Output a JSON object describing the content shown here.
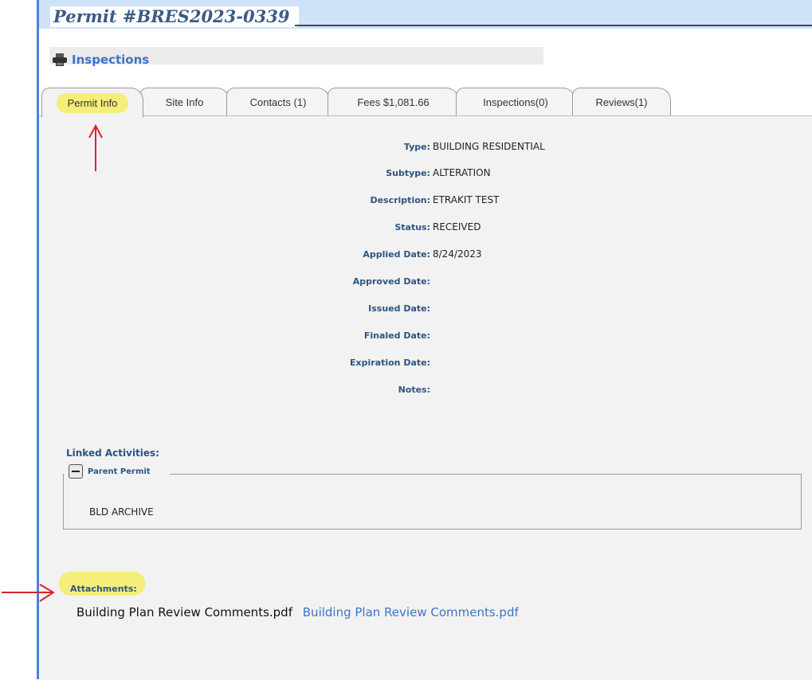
{
  "header": {
    "title": "Permit #BRES2023-0339",
    "inspections_link": "Inspections"
  },
  "tabs": [
    {
      "label": "Permit Info",
      "active": true
    },
    {
      "label": "Site Info"
    },
    {
      "label": "Contacts (1)"
    },
    {
      "label": "Fees $1,081.66"
    },
    {
      "label": "Inspections(0)"
    },
    {
      "label": "Reviews(1)"
    }
  ],
  "fields": [
    {
      "label": "Type:",
      "value": "BUILDING RESIDENTIAL"
    },
    {
      "label": "Subtype:",
      "value": "ALTERATION"
    },
    {
      "label": "Description:",
      "value": "ETRAKIT TEST"
    },
    {
      "label": "Status:",
      "value": "RECEIVED"
    },
    {
      "label": "Applied Date:",
      "value": "8/24/2023"
    },
    {
      "label": "Approved Date:",
      "value": ""
    },
    {
      "label": "Issued Date:",
      "value": ""
    },
    {
      "label": "Finaled Date:",
      "value": ""
    },
    {
      "label": "Expiration Date:",
      "value": ""
    },
    {
      "label": "Notes:",
      "value": ""
    }
  ],
  "linked_activities": {
    "title": "Linked Activities:",
    "group_label": "Parent Permit",
    "items": [
      "BLD ARCHIVE"
    ]
  },
  "attachments": {
    "title": "Attachments:",
    "file_name": "Building Plan Review Comments.pdf",
    "file_link": "Building Plan Review Comments.pdf"
  },
  "colors": {
    "accent": "#3d74c9",
    "label": "#2e557f",
    "highlight": "#f5ee7a",
    "annotation": "#d9242b"
  }
}
